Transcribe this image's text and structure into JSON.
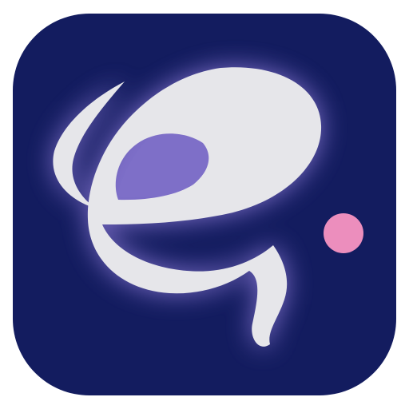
{
  "app_icon": {
    "name": "e-logo",
    "background_color": "#131c5f",
    "glow_color": "#8a78d4",
    "letter_color": "#e6e6ea",
    "dot_color": "#ec8ebd"
  }
}
